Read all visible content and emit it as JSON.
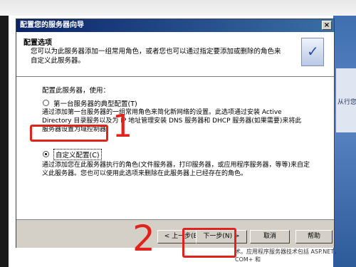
{
  "dialog": {
    "title": "配置您的服务器向导",
    "close_glyph": "×",
    "header": {
      "title": "配置选项",
      "description": "您可以为此服务器添加一组常用角色，或者您也可以通过指定要添加或删除的角色来自定义此服务器。"
    },
    "use_label": "配置此服务器，使用：",
    "options": [
      {
        "label": "第一台服务器的典型配置(T)",
        "selected": false,
        "description": "通过添加第一台服务器的一组常用角色来简化新网络的设置。此选项通过安装 Active Directory 目录服务以及为 IP 地址管理安装 DNS 服务器和 DHCP 服务器(如果需要)来将此服务器设置为域控制器。"
      },
      {
        "label": "自定义配置(C)",
        "selected": true,
        "description": "通过添加您在此服务器执行的角色(文件服务器，打印服务器，或应用程序服务器，等等)来自定义此服务器。您也可以使用此选项来删除在此服务器上已经存在的角色。"
      }
    ],
    "buttons": {
      "back": "< 上一步(B)",
      "next": "下一步(N) >",
      "cancel": "取消",
      "help": "帮助"
    }
  },
  "background": {
    "right_text": "从行您",
    "bottom_text": "术。应用程序服务器技术包括 ASP.NET，COM+ 和"
  },
  "annotations": {
    "step1": "1",
    "step2": "2",
    "color": "#e0241b"
  }
}
